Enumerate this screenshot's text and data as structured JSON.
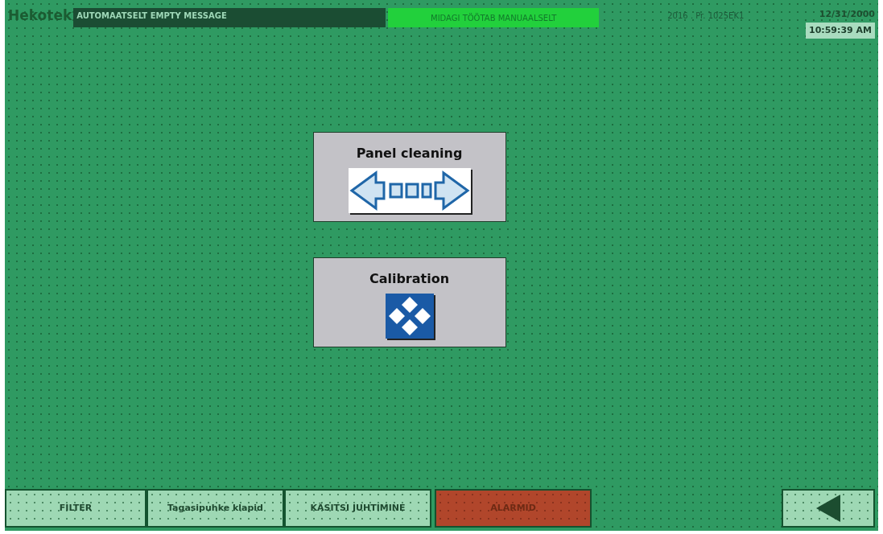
{
  "header": {
    "logo": "Hekotek",
    "message": "AUTOMAATSELT EMPTY MESSAGE",
    "status": "MIDAGI TÖÖTAB MANUAALSELT",
    "project": "2016 . Pr. 1025EK1",
    "date": "12/31/2000",
    "time": "10:59:39 AM"
  },
  "panels": [
    {
      "title": "Panel cleaning",
      "kind": "arrows"
    },
    {
      "title": "Calibration",
      "kind": "cross"
    }
  ],
  "nav_buttons": [
    {
      "label": "FILTER",
      "kind": "normal"
    },
    {
      "label": "Tagasipuhke klapid",
      "kind": "normal"
    },
    {
      "label": "KÄSITSI JUHTIMINE",
      "kind": "normal"
    },
    {
      "label": "ALARMID",
      "kind": "alarm"
    }
  ]
}
